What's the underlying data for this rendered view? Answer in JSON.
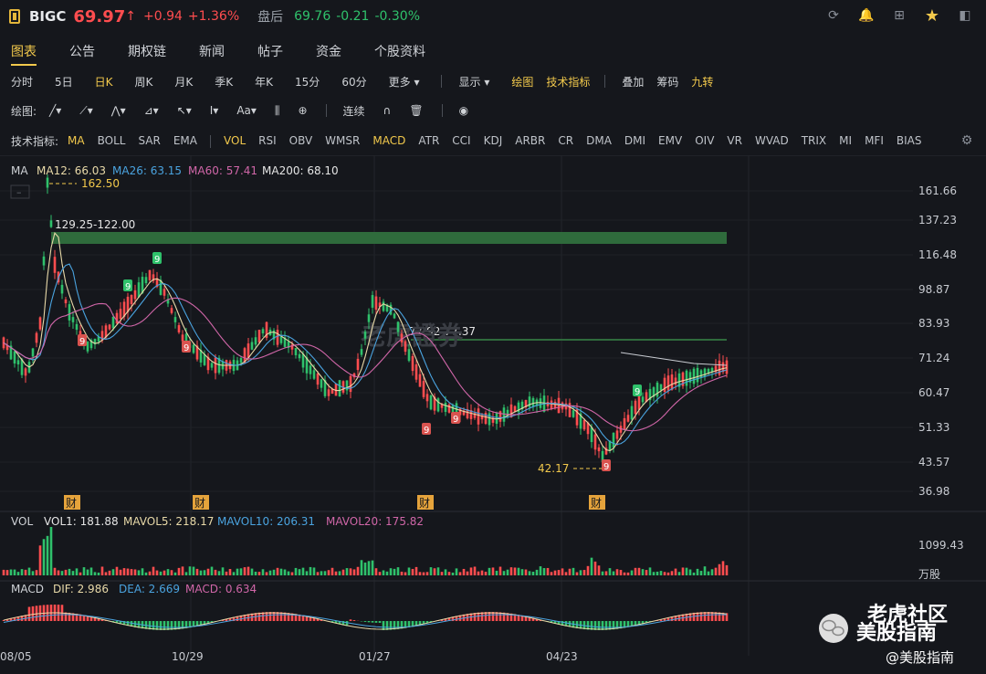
{
  "header": {
    "ticker": "BIGC",
    "price": "69.97",
    "arrow": "↑",
    "change": "+0.94",
    "change_pct": "+1.36%",
    "after_hours_label": "盘后",
    "after_hours_price": "69.76",
    "after_hours_change": "-0.21",
    "after_hours_pct": "-0.30%",
    "icons": [
      "refresh-icon",
      "bell-icon",
      "grid-icon",
      "star-icon",
      "panel-icon"
    ],
    "up_color": "#ff4d4f",
    "down_color": "#2fc16b",
    "accent": "#f2c94c"
  },
  "tabs": [
    "图表",
    "公告",
    "期权链",
    "新闻",
    "帖子",
    "资金",
    "个股资料"
  ],
  "periods": [
    "分时",
    "5日",
    "日K",
    "周K",
    "月K",
    "季K",
    "年K",
    "15分",
    "60分",
    "更多"
  ],
  "toolbar": {
    "display": "显示",
    "draw_chart": "绘图",
    "tech_ind": "技术指标",
    "overlay": "叠加",
    "chips": "筹码",
    "nine": "九转"
  },
  "draw": {
    "label": "绘图:",
    "continuous": "连续"
  },
  "indicators": {
    "label": "技术指标:",
    "items": [
      "MA",
      "BOLL",
      "SAR",
      "EMA",
      "VOL",
      "RSI",
      "OBV",
      "WMSR",
      "MACD",
      "ATR",
      "CCI",
      "KDJ",
      "ARBR",
      "CR",
      "DMA",
      "DMI",
      "EMV",
      "OIV",
      "VR",
      "WVAD",
      "TRIX",
      "MI",
      "MFI",
      "BIAS"
    ],
    "highlighted": [
      "MA",
      "VOL",
      "MACD"
    ]
  },
  "legend": {
    "ma": "MA",
    "ma12": "MA12: 66.03",
    "ma26": "MA26: 63.15",
    "ma60": "MA60: 57.41",
    "ma200": "MA200: 68.10",
    "vol": "VOL",
    "vol1": "VOL1: 181.88",
    "mavol5": "MAVOL5: 218.17",
    "mavol10": "MAVOL10: 206.31",
    "mavol20": "MAVOL20: 175.82",
    "macd": "MACD",
    "dif": "DIF: 2.986",
    "dea": "DEA: 2.669",
    "macd_val": "MACD: 0.634"
  },
  "price_axis": [
    "161.66",
    "137.23",
    "116.48",
    "98.87",
    "83.93",
    "71.24",
    "60.47",
    "51.33",
    "43.57",
    "36.98"
  ],
  "vol_axis": [
    "1099.43",
    "万股"
  ],
  "dates": [
    "08/05",
    "10/29",
    "01/27",
    "04/23"
  ],
  "annotations": {
    "high": "162.50",
    "low": "42.17",
    "zone1": "129.25-122.00",
    "zone2": "77.92-77.37",
    "earnings": "财",
    "nine": "9"
  },
  "watermark": {
    "line1": "老虎社区",
    "line2": "美股指南",
    "line3": "@美股指南",
    "chart_wm": "老虎證券"
  },
  "colors": {
    "ma12": "#e8d9a8",
    "ma26": "#4aa3df",
    "ma60": "#d066a8",
    "ma200": "#c9ccd2",
    "zone": "#2f6b3c"
  }
}
